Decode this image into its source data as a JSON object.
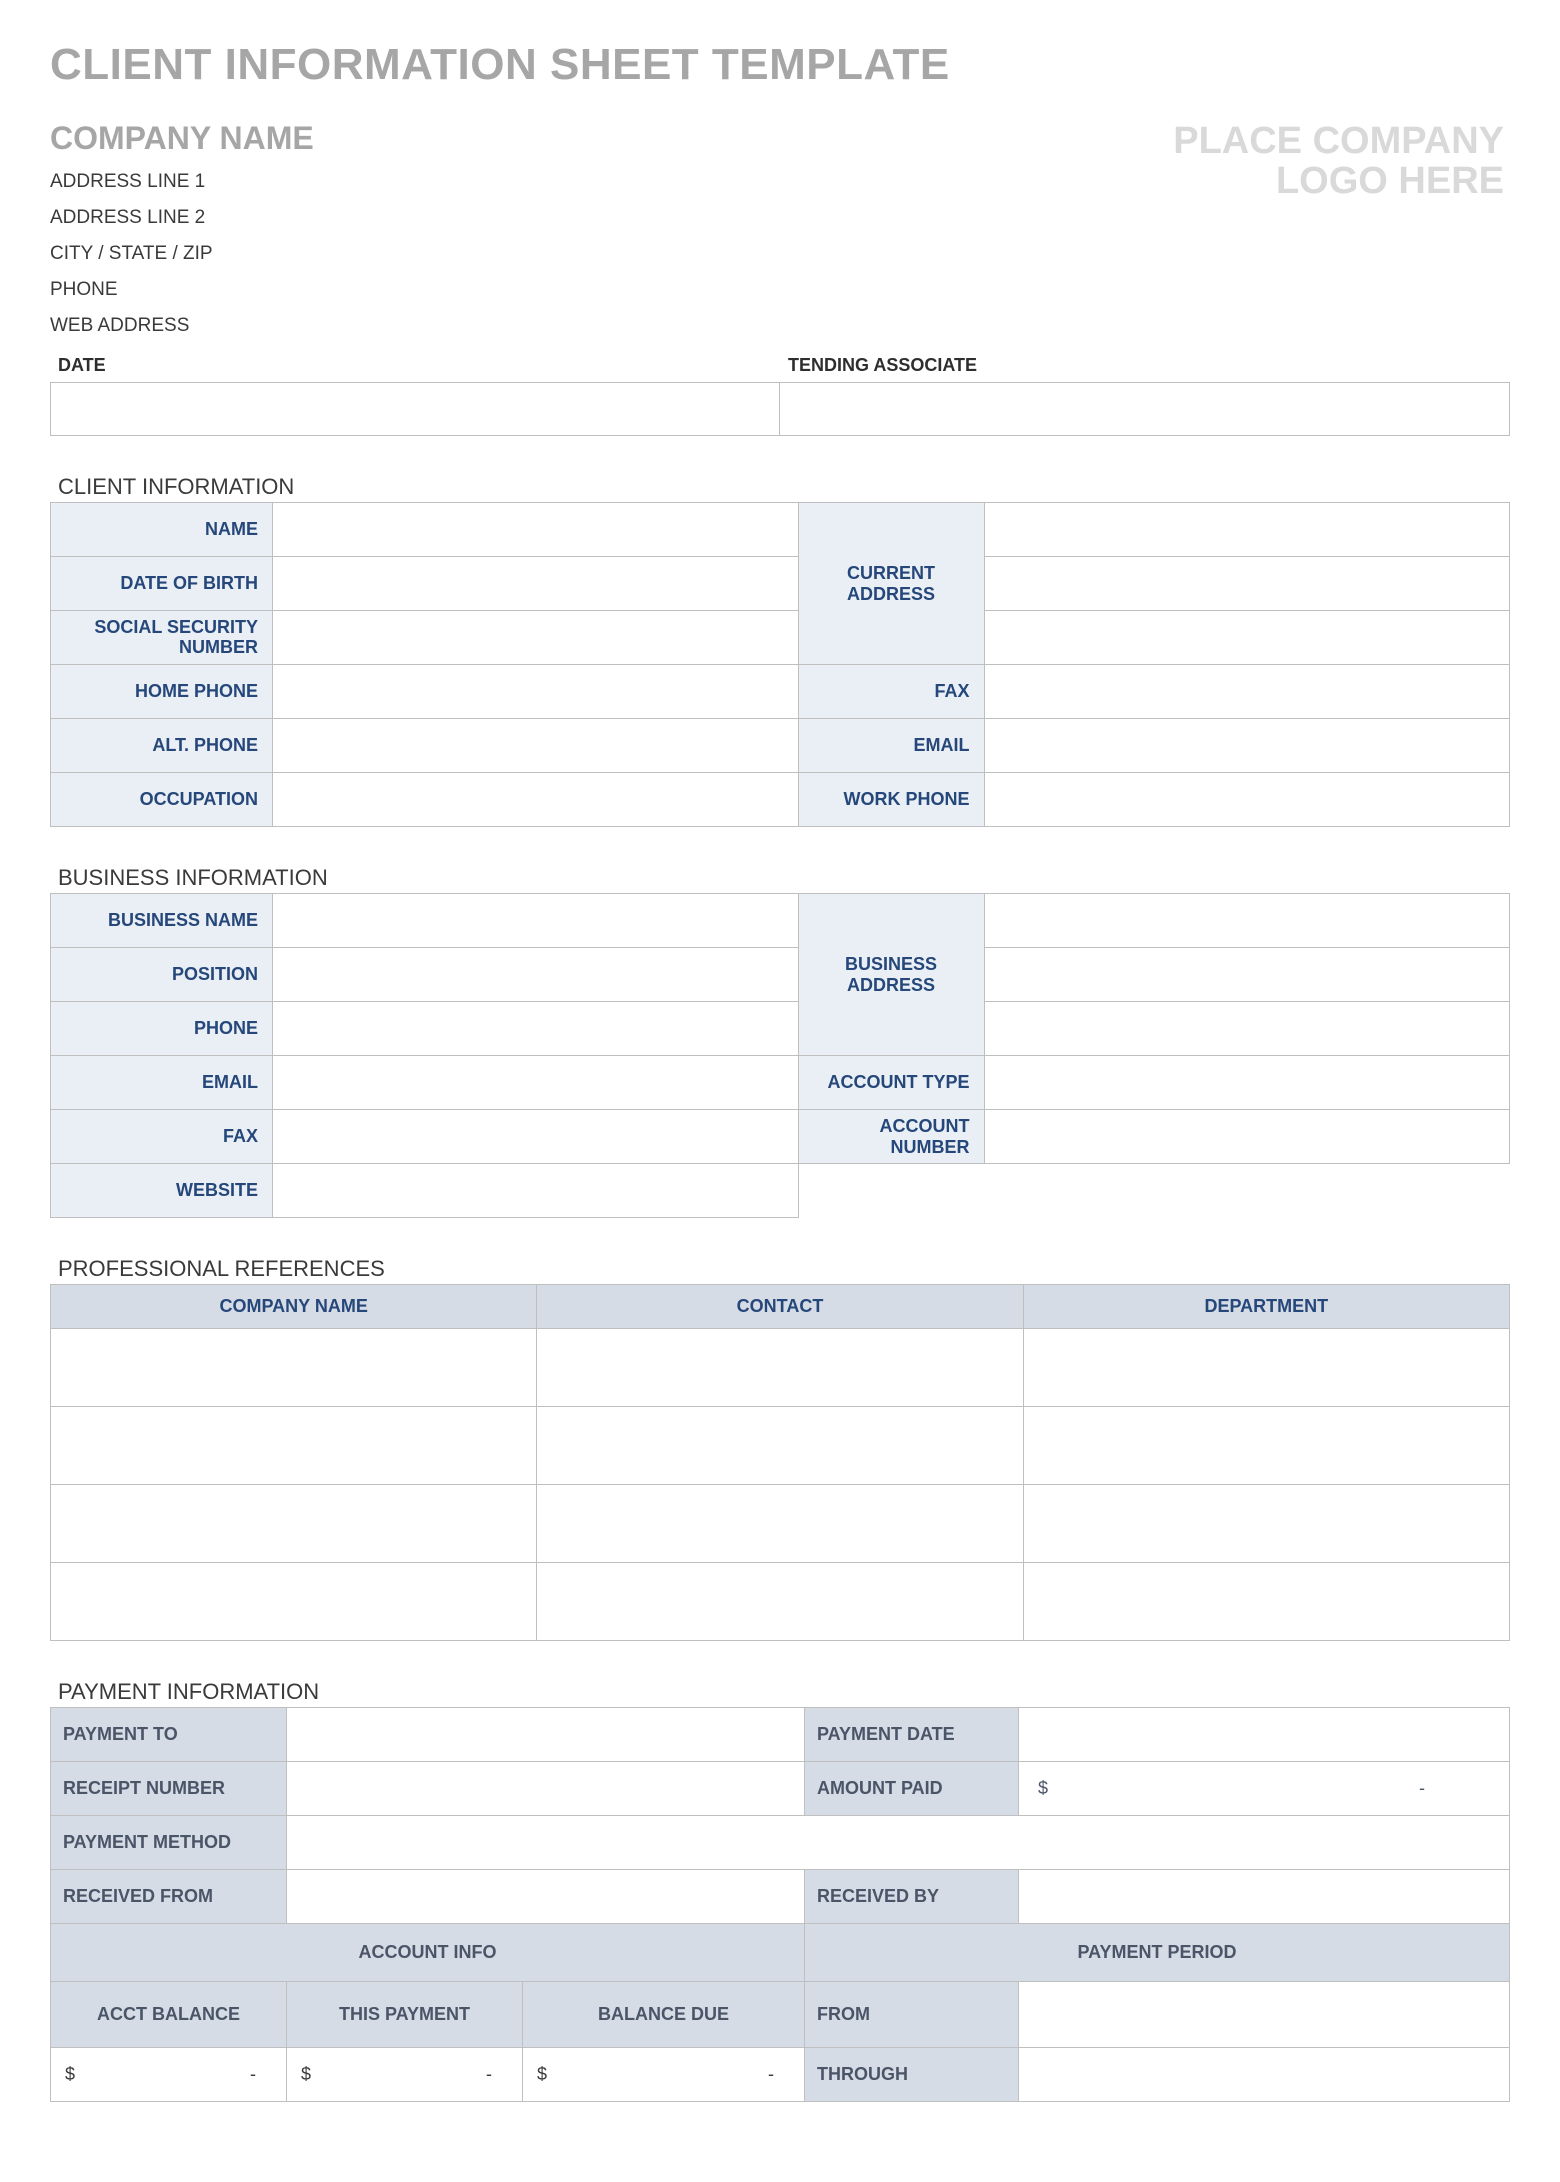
{
  "title": "CLIENT INFORMATION SHEET TEMPLATE",
  "company": {
    "name": "COMPANY NAME",
    "address1": "ADDRESS LINE 1",
    "address2": "ADDRESS LINE 2",
    "cityStateZip": "CITY / STATE / ZIP",
    "phone": "PHONE",
    "web": "WEB ADDRESS",
    "logoPlaceholder1": "PLACE COMPANY",
    "logoPlaceholder2": "LOGO HERE"
  },
  "dateRow": {
    "dateLabel": "DATE",
    "tendingLabel": "TENDING ASSOCIATE"
  },
  "sections": {
    "clientInfo": "CLIENT INFORMATION",
    "businessInfo": "BUSINESS INFORMATION",
    "profRefs": "PROFESSIONAL REFERENCES",
    "paymentInfo": "PAYMENT INFORMATION"
  },
  "clientInfo": {
    "name": "NAME",
    "dob": "DATE OF BIRTH",
    "ssn": "SOCIAL SECURITY NUMBER",
    "homePhone": "HOME PHONE",
    "altPhone": "ALT. PHONE",
    "occupation": "OCCUPATION",
    "currentAddress": "CURRENT ADDRESS",
    "fax": "FAX",
    "email": "EMAIL",
    "workPhone": "WORK PHONE"
  },
  "businessInfo": {
    "businessName": "BUSINESS NAME",
    "position": "POSITION",
    "phone": "PHONE",
    "email": "EMAIL",
    "fax": "FAX",
    "website": "WEBSITE",
    "businessAddress": "BUSINESS ADDRESS",
    "accountType": "ACCOUNT TYPE",
    "accountNumber": "ACCOUNT NUMBER"
  },
  "profRefs": {
    "companyName": "COMPANY NAME",
    "contact": "CONTACT",
    "department": "DEPARTMENT"
  },
  "paymentInfo": {
    "paymentTo": "PAYMENT TO",
    "receiptNumber": "RECEIPT NUMBER",
    "paymentMethod": "PAYMENT METHOD",
    "receivedFrom": "RECEIVED FROM",
    "paymentDate": "PAYMENT DATE",
    "amountPaid": "AMOUNT PAID",
    "receivedBy": "RECEIVED BY",
    "accountInfo": "ACCOUNT INFO",
    "paymentPeriod": "PAYMENT PERIOD",
    "acctBalance": "ACCT BALANCE",
    "thisPayment": "THIS PAYMENT",
    "balanceDue": "BALANCE DUE",
    "from": "FROM",
    "through": "THROUGH",
    "dollar": "$",
    "dash": "-"
  }
}
